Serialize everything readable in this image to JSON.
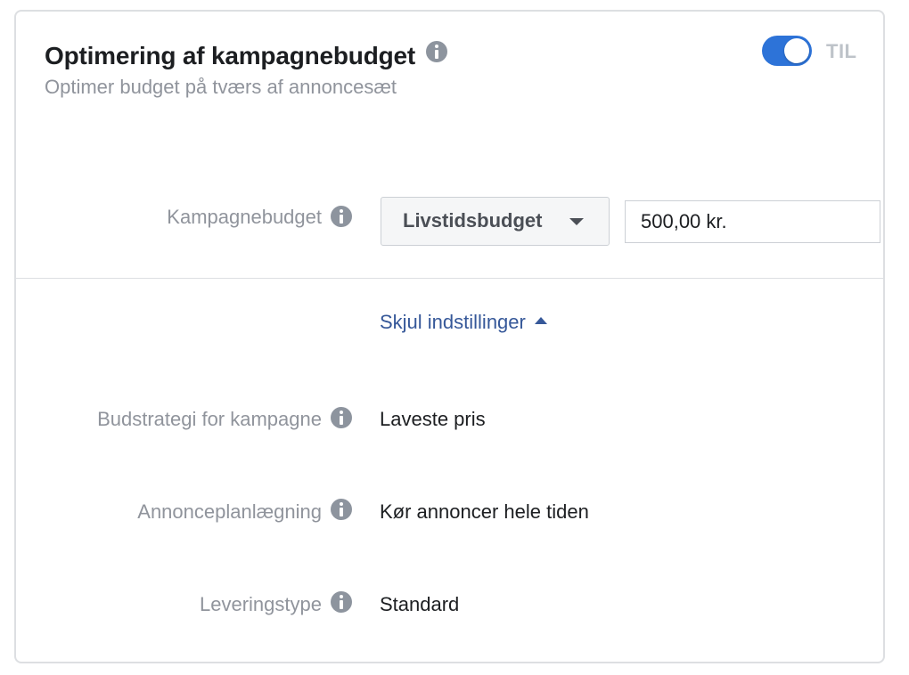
{
  "header": {
    "title": "Optimering af kampagnebudget",
    "subtitle": "Optimer budget på tværs af annoncesæt",
    "toggle_state": "TIL",
    "toggle_on": true
  },
  "budget": {
    "label": "Kampagnebudget",
    "type_selected": "Livstidsbudget",
    "amount_value": "500,00 kr."
  },
  "settings_link": "Skjul indstillinger",
  "rows": [
    {
      "label": "Budstrategi for kampagne",
      "value": "Laveste pris"
    },
    {
      "label": "Annonceplanlægning",
      "value": "Kør annoncer hele tiden"
    },
    {
      "label": "Leveringstype",
      "value": "Standard"
    }
  ],
  "colors": {
    "accent": "#2d73d8",
    "link": "#365899",
    "muted_text": "#90949c",
    "border": "#dddfe2"
  },
  "icons": [
    "info-icon",
    "caret-down-icon",
    "caret-up-icon"
  ]
}
